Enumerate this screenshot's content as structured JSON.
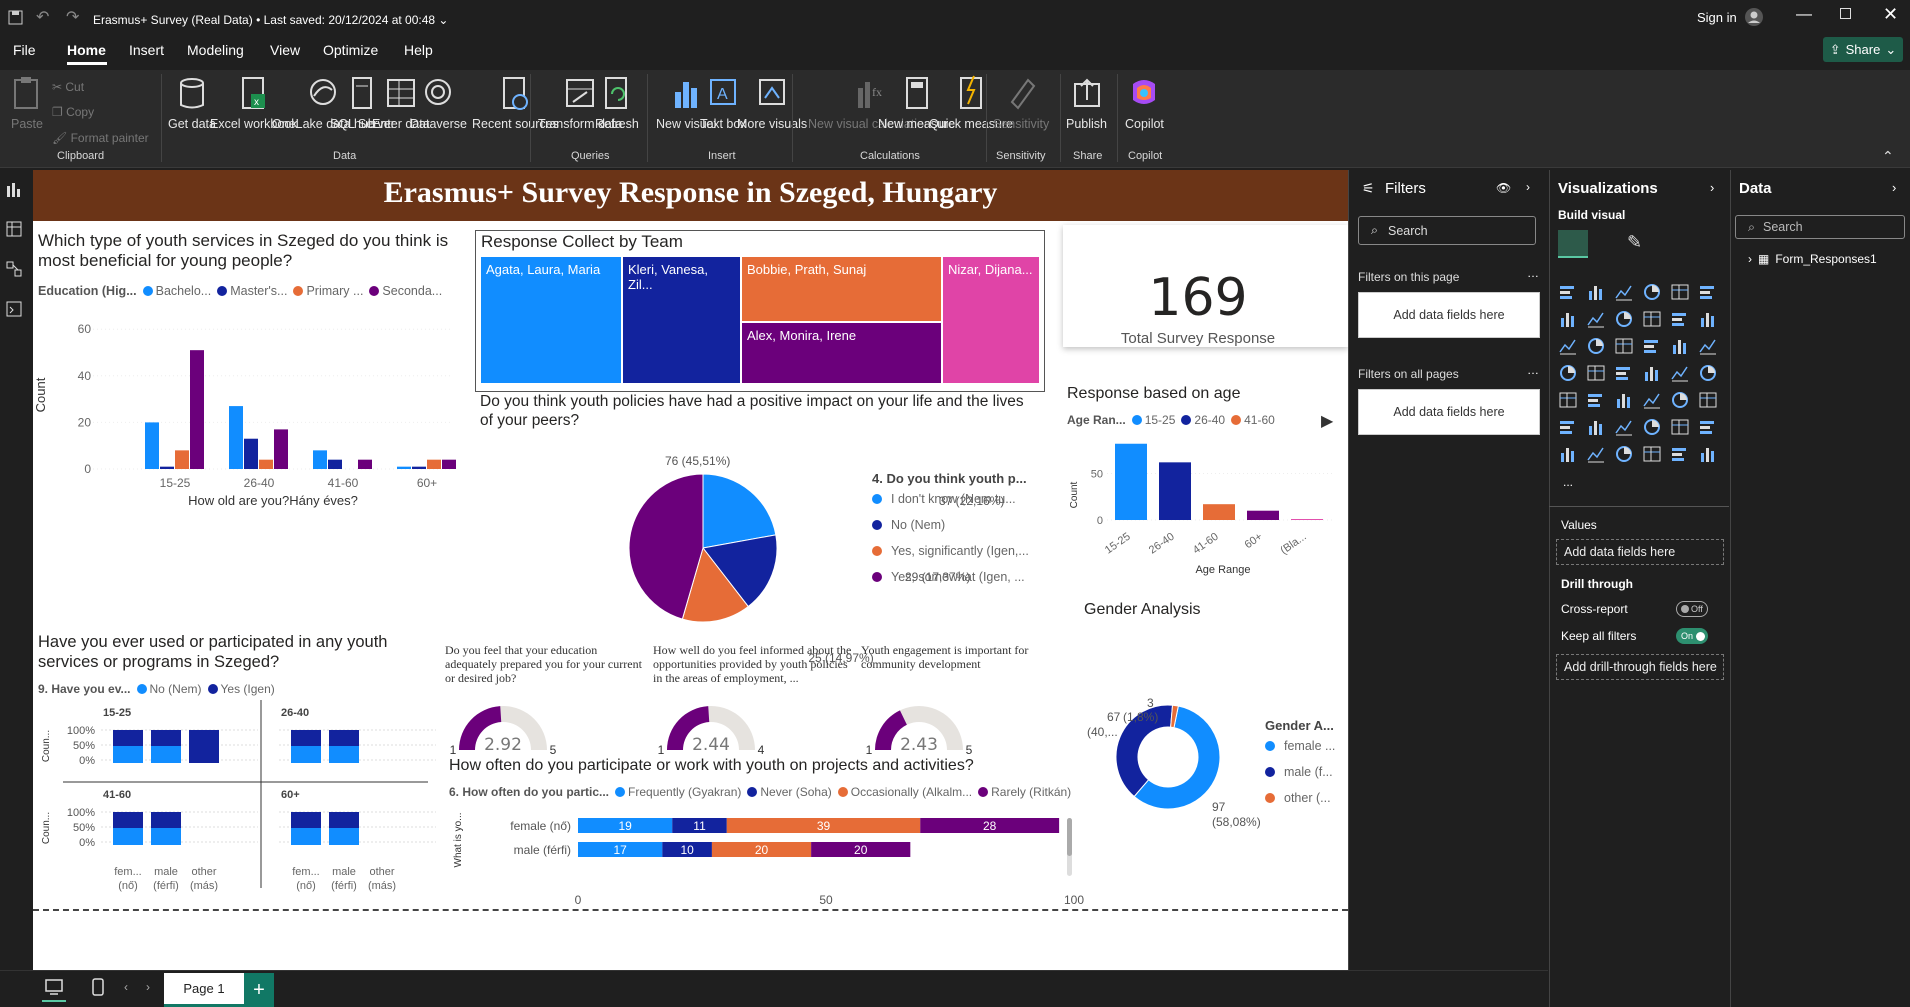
{
  "titlebar": {
    "title": "Erasmus+ Survey (Real Data)",
    "saved": "Last saved: 20/12/2024 at 00:48",
    "sign_in": "Sign in"
  },
  "menu": {
    "file": "File",
    "home": "Home",
    "insert": "Insert",
    "modeling": "Modeling",
    "view": "View",
    "optimize": "Optimize",
    "help": "Help",
    "share": "Share"
  },
  "ribbon": {
    "paste": "Paste",
    "cut": "Cut",
    "copy": "Copy",
    "format_painter": "Format painter",
    "clipboard": "Clipboard",
    "get_data": "Get data",
    "excel": "Excel workbook",
    "onelake": "OneLake data hub",
    "sql": "SQL Server",
    "enter": "Enter data",
    "dataverse": "Dataverse",
    "recent": "Recent sources",
    "data": "Data",
    "transform": "Transform data",
    "refresh": "Refresh",
    "queries": "Queries",
    "new_visual": "New visual",
    "text_box": "Text box",
    "more_visuals": "More visuals",
    "insert": "Insert",
    "new_visual_calc": "New visual calculation",
    "new_measure": "New measure",
    "quick_measure": "Quick measure",
    "calculations": "Calculations",
    "sensitivity_btn": "Sensitivity",
    "sensitivity": "Sensitivity",
    "publish": "Publish",
    "share": "Share",
    "copilot_btn": "Copilot",
    "copilot": "Copilot"
  },
  "report": {
    "title": "Erasmus+ Survey Response in Szeged, Hungary",
    "edu_chart": {
      "title": "Which type of youth services in Szeged do you think is most beneficial for young people?",
      "legend_title": "Education (Hig...",
      "xlabel": "How old are you?Hány éves?",
      "ylabel": "Count",
      "y_ticks": [
        "60",
        "40",
        "20",
        "0"
      ],
      "series_labels": [
        "Bachelo...",
        "Master's...",
        "Primary ...",
        "Seconda..."
      ]
    },
    "treemap": {
      "title": "Response Collect by Team",
      "t1": "Agata, Laura, Maria",
      "t2": "Kleri, Vanesa, Zil...",
      "t3": "Bobbie, Prath, Sunaj",
      "t4": "Nizar, Dijana...",
      "t5": "Alex, Monira, Irene"
    },
    "card": {
      "value": "169",
      "label": "Total Survey Response"
    },
    "pie": {
      "title": "Do you think youth policies have had a positive impact on your life and the lives of your peers?",
      "legend_title": "4. Do you think youth p...",
      "labels": [
        "I don't know (Nem tu...",
        "No (Nem)",
        "Yes, significantly (Igen,...",
        "Yes, somewhat (Igen, ..."
      ],
      "data_labels": [
        "37 (22,16%)",
        "29 (17,37%)",
        "25 (14,97%)",
        "76 (45,51%)"
      ]
    },
    "age_chart": {
      "title": "Response based on age",
      "legend_title": "Age Ran...",
      "legend": [
        "15-25",
        "26-40",
        "41-60"
      ],
      "xlabel": "Age Range",
      "ylabel": "Count",
      "y_ticks": [
        "50",
        "0"
      ],
      "x_labels": [
        "15-25",
        "26-40",
        "41-60",
        "60+",
        "(Bla..."
      ]
    },
    "services": {
      "title": "Have you ever used or participated in any youth services or programs in Szeged?",
      "legend_title": "9. Have you ev...",
      "legend": [
        "No (Nem)",
        "Yes (Igen)"
      ],
      "panels": [
        "15-25",
        "26-40",
        "41-60",
        "60+"
      ],
      "y_ticks": [
        "100%",
        "50%",
        "0%"
      ],
      "ylabel": "Coun...",
      "x_labels": [
        "fem... (nő)",
        "male (férfi)",
        "other (más)"
      ]
    },
    "gauges": [
      {
        "title": "Do you feel that your education adequately prepared you for your current or desired job?",
        "min": "1",
        "max": "5",
        "value": "2.92"
      },
      {
        "title": "How well do you feel informed about the opportunities provided by youth policies in the areas of employment, ...",
        "min": "1",
        "max": "4",
        "value": "2.44"
      },
      {
        "title": "Youth engagement is important for community development",
        "min": "1",
        "max": "5",
        "value": "2.43"
      }
    ],
    "gender": {
      "title": "Gender Analysis",
      "legend_title": "Gender A...",
      "legend": [
        "female ...",
        "male (f...",
        "other (..."
      ],
      "label_top": "3",
      "label_top2": "(1,8%)",
      "label_left": "67",
      "label_left2": "(40,...",
      "label_right": "97",
      "label_right2": "(58,08%)"
    },
    "freq": {
      "title": "How often do you participate or work with youth on projects and activities?",
      "legend_title": "6. How often do you partic...",
      "legend": [
        "Frequently (Gyakran)",
        "Never (Soha)",
        "Occasionally (Alkalm...",
        "Rarely (Ritkán)"
      ],
      "ylabel": "What is yo...",
      "rows": [
        "female (nő)",
        "male (férfi)"
      ],
      "female_vals": [
        "19",
        "11",
        "39",
        "28"
      ],
      "male_vals": [
        "17",
        "10",
        "20",
        "20"
      ],
      "x_ticks": [
        "0",
        "50",
        "100"
      ]
    }
  },
  "chart_data": [
    {
      "type": "bar",
      "title": "Which type of youth services in Szeged do you think is most beneficial for young people?",
      "xlabel": "How old are you?Hány éves?",
      "ylabel": "Count",
      "categories": [
        "15-25",
        "26-40",
        "41-60",
        "60+"
      ],
      "ylim": [
        0,
        60
      ],
      "series": [
        {
          "name": "Bachelo...",
          "values": [
            20,
            27,
            8,
            1
          ]
        },
        {
          "name": "Master's...",
          "values": [
            1,
            13,
            4,
            1
          ]
        },
        {
          "name": "Primary ...",
          "values": [
            8,
            4,
            0,
            4
          ]
        },
        {
          "name": "Seconda...",
          "values": [
            51,
            17,
            4,
            4
          ]
        }
      ]
    },
    {
      "type": "pie",
      "title": "Do you think youth policies have had a positive impact on your life and the lives of your peers?",
      "categories": [
        "I don't know (Nem tu...",
        "No (Nem)",
        "Yes, significantly (Igen,...",
        "Yes, somewhat (Igen, ..."
      ],
      "values": [
        37,
        29,
        25,
        76
      ]
    },
    {
      "type": "bar",
      "title": "Response based on age",
      "xlabel": "Age Range",
      "ylabel": "Count",
      "categories": [
        "15-25",
        "26-40",
        "41-60",
        "60+",
        "(Bla..."
      ],
      "values": [
        82,
        62,
        17,
        10,
        1
      ],
      "ylim": [
        0,
        90
      ]
    },
    {
      "type": "pie",
      "title": "Gender Analysis",
      "categories": [
        "female ...",
        "male (f...",
        "other (..."
      ],
      "values": [
        97,
        67,
        3
      ]
    },
    {
      "type": "bar",
      "title": "How often do you participate or work with youth on projects and activities?",
      "categories": [
        "female (nő)",
        "male (férfi)"
      ],
      "xlim": [
        0,
        100
      ],
      "series": [
        {
          "name": "Frequently (Gyakran)",
          "values": [
            19,
            17
          ]
        },
        {
          "name": "Never (Soha)",
          "values": [
            11,
            10
          ]
        },
        {
          "name": "Occasionally (Alkalm...",
          "values": [
            39,
            20
          ]
        },
        {
          "name": "Rarely (Ritkán)",
          "values": [
            28,
            20
          ]
        }
      ]
    }
  ],
  "filters": {
    "title": "Filters",
    "search": "Search",
    "on_page": "Filters on this page",
    "add1": "Add data fields here",
    "on_all": "Filters on all pages",
    "add2": "Add data fields here"
  },
  "viz": {
    "title": "Visualizations",
    "build": "Build visual",
    "values": "Values",
    "add_values": "Add data fields here",
    "drill": "Drill through",
    "cross": "Cross-report",
    "cross_state": "Off",
    "keep": "Keep all filters",
    "keep_state": "On",
    "add_drill": "Add drill-through fields here",
    "more": "..."
  },
  "datapane": {
    "title": "Data",
    "search": "Search",
    "table": "Form_Responses1"
  },
  "bottom": {
    "page": "Page 1",
    "add": "+"
  }
}
